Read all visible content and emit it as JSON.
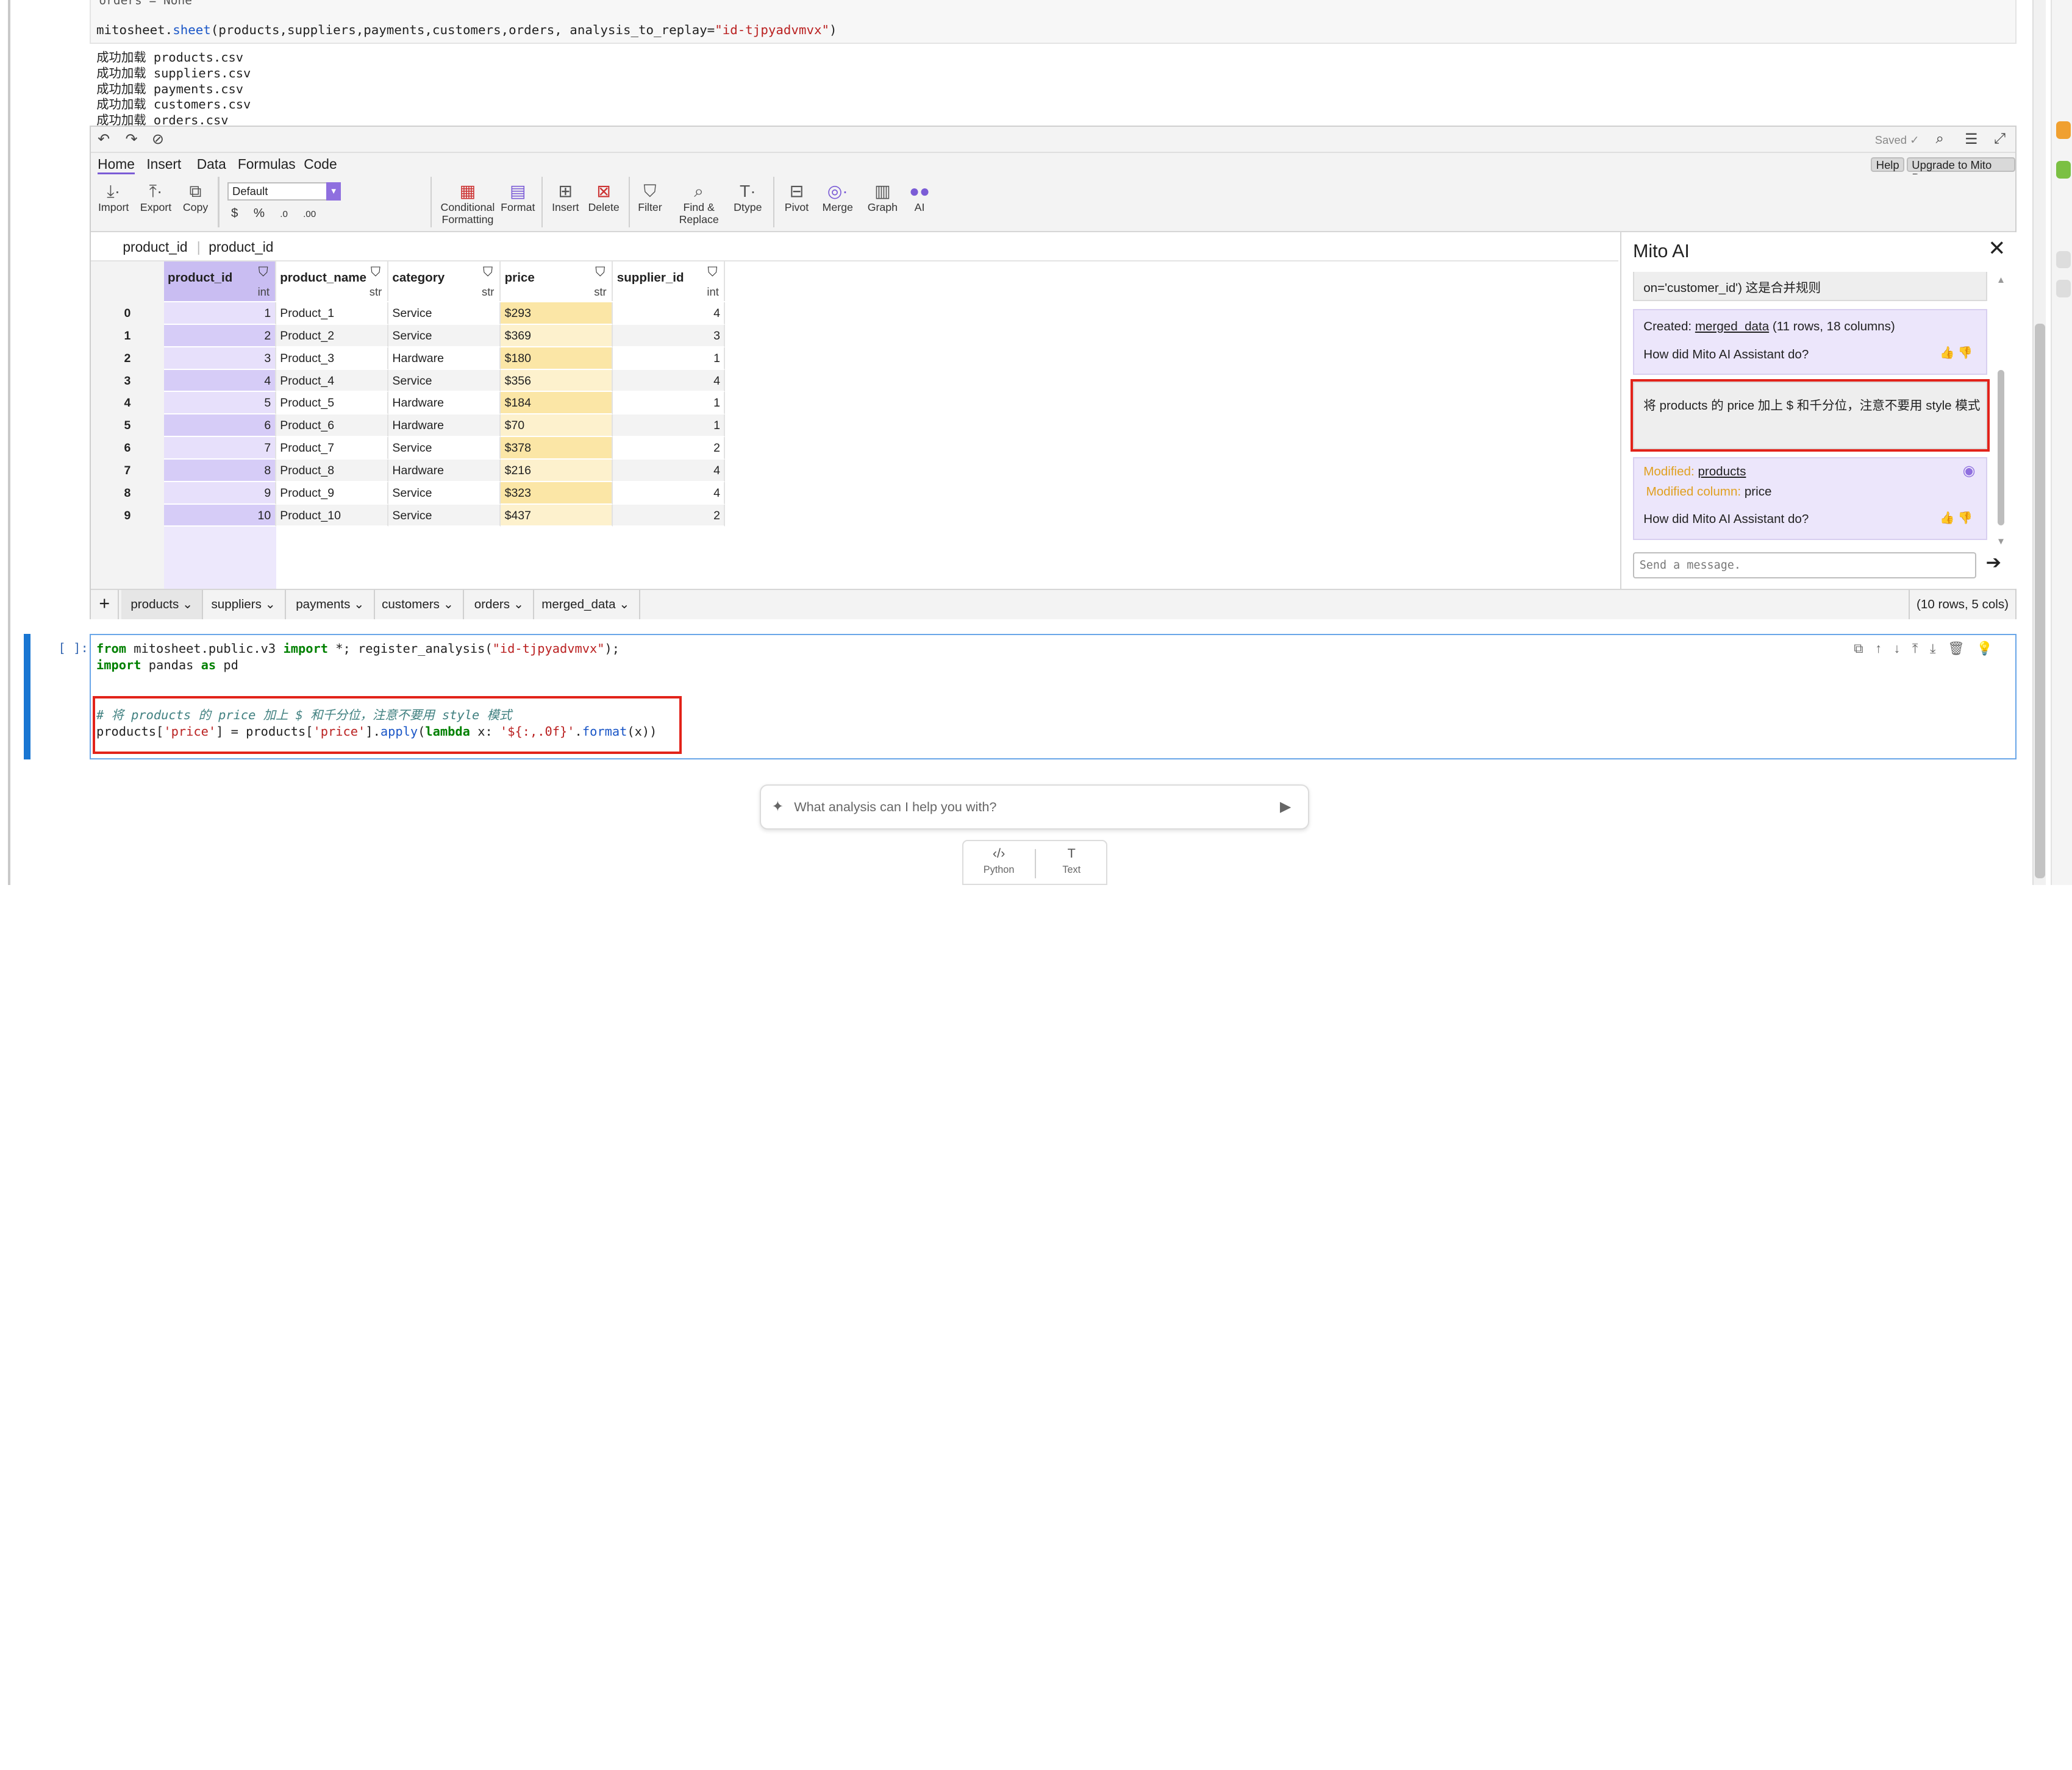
{
  "code_preview": {
    "line1": "    orders = None",
    "call_obj": "mitosheet.",
    "call_fn": "sheet",
    "call_args": "(products,suppliers,payments,customers,orders, analysis_to_replay=",
    "call_str": "\"id-tjpyadvmvx\"",
    "call_end": ")"
  },
  "output_lines": [
    "成功加载 products.csv",
    "成功加载 suppliers.csv",
    "成功加载 payments.csv",
    "成功加载 customers.csv",
    "成功加载 orders.csv"
  ],
  "mito": {
    "saved": "Saved ✓",
    "menu": {
      "home": "Home",
      "insert": "Insert",
      "data": "Data",
      "formulas": "Formulas",
      "code": "Code",
      "help": "Help",
      "upgrade": "Upgrade to Mito Pro"
    },
    "toolbar": {
      "import": "Import",
      "export": "Export",
      "copy": "Copy",
      "format_default": "Default",
      "dollar": "$",
      "percent": "%",
      "dec_inc": ".0",
      "dec_dec": ".00",
      "conditional": "Conditional",
      "formatting": "Formatting",
      "format": "Format",
      "insert": "Insert",
      "delete": "Delete",
      "filter": "Filter",
      "find": "Find &",
      "replace": "Replace",
      "dtype": "Dtype",
      "pivot": "Pivot",
      "merge": "Merge",
      "graph": "Graph",
      "ai": "AI"
    },
    "selected_col_a": "product_id",
    "selected_col_b": "product_id",
    "columns": [
      {
        "name": "product_id",
        "type": "int"
      },
      {
        "name": "product_name",
        "type": "str"
      },
      {
        "name": "category",
        "type": "str"
      },
      {
        "name": "price",
        "type": "str"
      },
      {
        "name": "supplier_id",
        "type": "int"
      }
    ],
    "rows": [
      {
        "idx": "0",
        "product_id": "1",
        "product_name": "Product_1",
        "category": "Service",
        "price": "$293",
        "supplier_id": "4"
      },
      {
        "idx": "1",
        "product_id": "2",
        "product_name": "Product_2",
        "category": "Service",
        "price": "$369",
        "supplier_id": "3"
      },
      {
        "idx": "2",
        "product_id": "3",
        "product_name": "Product_3",
        "category": "Hardware",
        "price": "$180",
        "supplier_id": "1"
      },
      {
        "idx": "3",
        "product_id": "4",
        "product_name": "Product_4",
        "category": "Service",
        "price": "$356",
        "supplier_id": "4"
      },
      {
        "idx": "4",
        "product_id": "5",
        "product_name": "Product_5",
        "category": "Hardware",
        "price": "$184",
        "supplier_id": "1"
      },
      {
        "idx": "5",
        "product_id": "6",
        "product_name": "Product_6",
        "category": "Hardware",
        "price": "$70",
        "supplier_id": "1"
      },
      {
        "idx": "6",
        "product_id": "7",
        "product_name": "Product_7",
        "category": "Service",
        "price": "$378",
        "supplier_id": "2"
      },
      {
        "idx": "7",
        "product_id": "8",
        "product_name": "Product_8",
        "category": "Hardware",
        "price": "$216",
        "supplier_id": "4"
      },
      {
        "idx": "8",
        "product_id": "9",
        "product_name": "Product_9",
        "category": "Service",
        "price": "$323",
        "supplier_id": "4"
      },
      {
        "idx": "9",
        "product_id": "10",
        "product_name": "Product_10",
        "category": "Service",
        "price": "$437",
        "supplier_id": "2"
      }
    ],
    "sheets": [
      "products",
      "suppliers",
      "payments",
      "customers",
      "orders",
      "merged_data"
    ],
    "row_count": "(10 rows, 5 cols)",
    "ai": {
      "title": "Mito AI",
      "prev_msg": "on='customer_id') 这是合并规则",
      "created_label": "Created: ",
      "created_link": "merged_data",
      "created_rest": " (11 rows, 18 columns)",
      "feedback": "How did Mito AI Assistant do?",
      "user_msg": "将 products 的 price 加上 $ 和千分位，注意不要用 style 模式",
      "modified_label": "Modified: ",
      "modified_link": "products",
      "modified_col_label": "Modified column: ",
      "modified_col": "price",
      "input_placeholder": "Send a message."
    }
  },
  "cell": {
    "prompt": "[ ]:",
    "line1a": "from",
    "line1b": " mitosheet.public.v3 ",
    "line1c": "import",
    "line1d": " *; register_analysis(",
    "line1e": "\"id-tjpyadvmvx\"",
    "line1f": ");",
    "line2a": "import",
    "line2b": " pandas ",
    "line2c": "as",
    "line2d": " pd",
    "comment": "# 将 products 的 price 加上 $ 和千分位，注意不要用 style 模式",
    "line5a": "products[",
    "line5b": "'price'",
    "line5c": "] = products[",
    "line5d": "'price'",
    "line5e": "].",
    "line5f": "apply",
    "line5g": "(",
    "line5h": "lambda",
    "line5i": " x: ",
    "line5j": "'${:,.0f}'",
    "line5k": ".",
    "line5l": "format",
    "line5m": "(x))"
  },
  "ask_placeholder": "What analysis can I help you with?",
  "bottom": {
    "python": "Python",
    "text": "Text"
  },
  "colors": {
    "accent": "#7b5cd6",
    "selected_col": "#c9bdf2",
    "price_col": "#fbe6a6",
    "red_box": "#e2231a",
    "cell_bar": "#1976d2"
  }
}
